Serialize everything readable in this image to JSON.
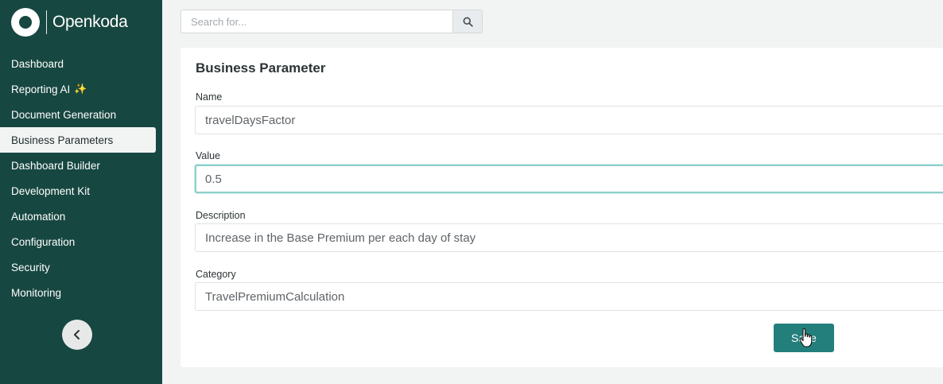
{
  "brand": {
    "name": "Openkoda"
  },
  "sidebar": {
    "items": [
      {
        "label": "Dashboard",
        "active": false
      },
      {
        "label": "Reporting AI",
        "active": false,
        "suffix": "✨"
      },
      {
        "label": "Document Generation",
        "active": false
      },
      {
        "label": "Business Parameters",
        "active": true
      },
      {
        "label": "Dashboard Builder",
        "active": false
      },
      {
        "label": "Development Kit",
        "active": false
      },
      {
        "label": "Automation",
        "active": false
      },
      {
        "label": "Configuration",
        "active": false
      },
      {
        "label": "Security",
        "active": false
      },
      {
        "label": "Monitoring",
        "active": false
      }
    ],
    "collapse_icon": "chevron-left-icon"
  },
  "search": {
    "placeholder": "Search for...",
    "value": "",
    "icon": "search-icon"
  },
  "form": {
    "title": "Business Parameter",
    "fields": [
      {
        "label": "Name",
        "value": "travelDaysFactor"
      },
      {
        "label": "Value",
        "value": "0.5",
        "focused": true
      },
      {
        "label": "Description",
        "value": "Increase in the Base Premium per each day of stay"
      },
      {
        "label": "Category",
        "value": "TravelPremiumCalculation"
      }
    ],
    "save_label": "Save"
  },
  "colors": {
    "sidebar_bg": "#174741",
    "accent": "#227f7b",
    "page_bg": "#f2f3f3",
    "focus_border": "#8ccfcb"
  }
}
